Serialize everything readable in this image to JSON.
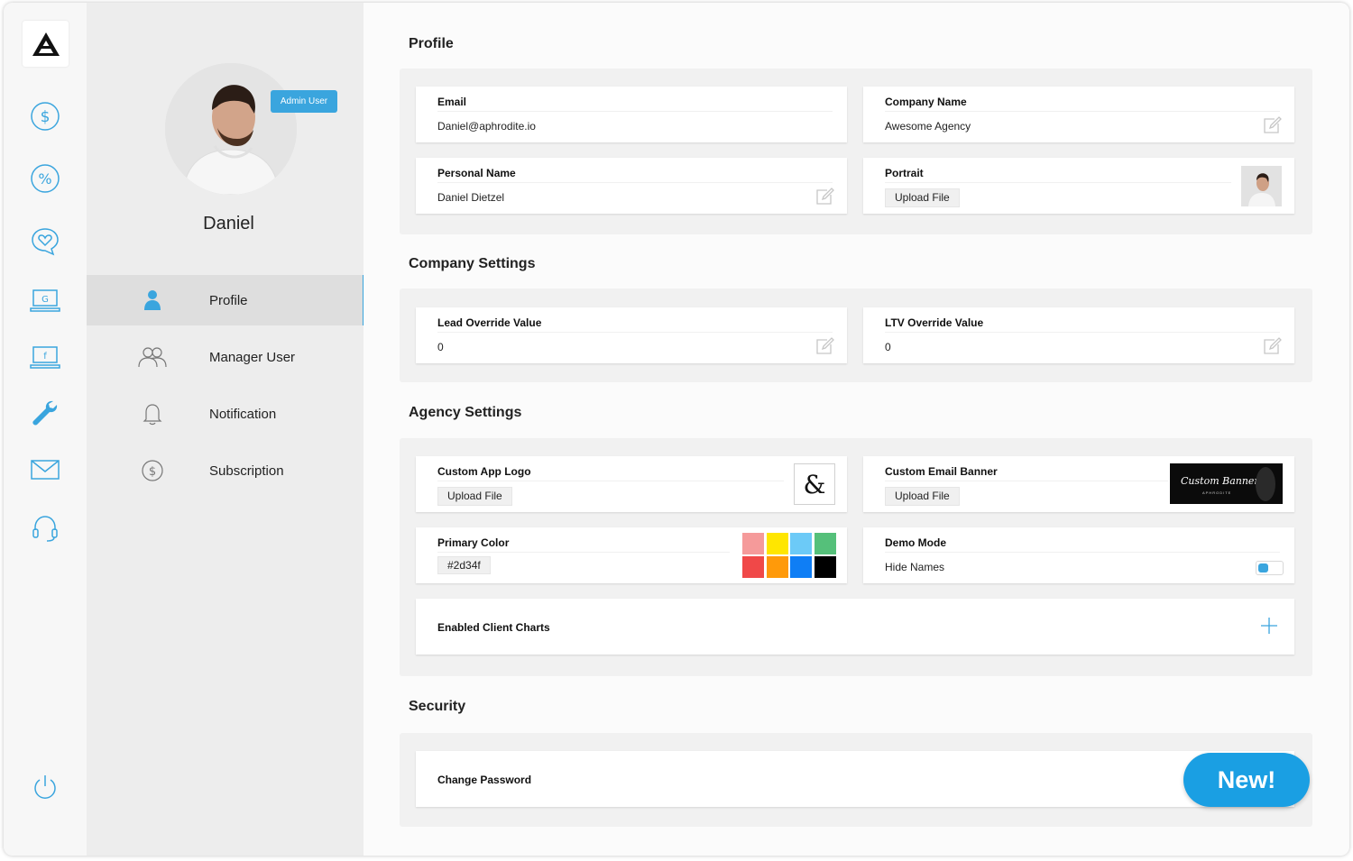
{
  "sidebar": {
    "icons": [
      "logo-triangle-icon",
      "dollar-icon",
      "percent-icon",
      "heart-chat-icon",
      "google-laptop-icon",
      "facebook-laptop-icon",
      "wrench-icon",
      "mail-icon",
      "headset-icon",
      "power-icon"
    ]
  },
  "profile_panel": {
    "user_name": "Daniel",
    "badge": "Admin User",
    "menu": [
      {
        "label": "Profile",
        "icon": "user-icon",
        "active": true
      },
      {
        "label": "Manager User",
        "icon": "users-icon",
        "active": false
      },
      {
        "label": "Notification",
        "icon": "bell-icon",
        "active": false
      },
      {
        "label": "Subscription",
        "icon": "dollar-circle-icon",
        "active": false
      }
    ]
  },
  "profile": {
    "title": "Profile",
    "email_label": "Email",
    "email": "Daniel@aphrodite.io",
    "company_label": "Company Name",
    "company": "Awesome Agency",
    "personal_label": "Personal Name",
    "personal": "Daniel Dietzel",
    "portrait_label": "Portrait",
    "upload": "Upload File"
  },
  "company_settings": {
    "title": "Company Settings",
    "lead_label": "Lead Override Value",
    "lead_value": "0",
    "ltv_label": "LTV Override Value",
    "ltv_value": "0"
  },
  "agency_settings": {
    "title": "Agency Settings",
    "logo_label": "Custom App Logo",
    "logo_glyph": "&",
    "upload": "Upload File",
    "banner_label": "Custom Email Banner",
    "banner_text": "Custom Banner",
    "banner_subtext": "APHRODITE",
    "color_label": "Primary Color",
    "color_value": "#2d34f",
    "swatches": [
      "#f59a9a",
      "#ffe600",
      "#6ccaf7",
      "#55c07a",
      "#f04848",
      "#ff9a0a",
      "#0f7ef5",
      "#000000"
    ],
    "demo_label": "Demo Mode",
    "demo_option": "Hide Names",
    "charts_label": "Enabled Client Charts"
  },
  "security": {
    "title": "Security",
    "password_label": "Change Password",
    "new_badge": "New!"
  },
  "colors": {
    "accent": "#3aa5de",
    "new_badge": "#1a9fe3"
  }
}
